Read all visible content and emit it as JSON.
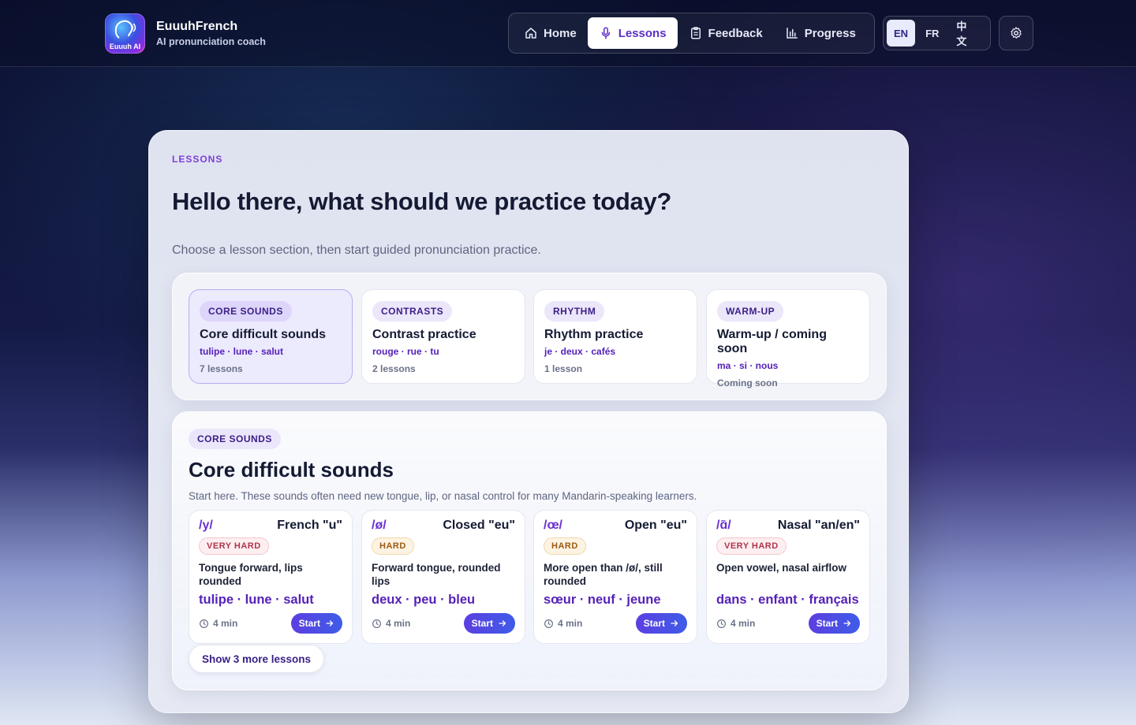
{
  "brand": {
    "logo_text": "Euuuh AI",
    "name": "EuuuhFrench",
    "tagline": "AI pronunciation coach"
  },
  "nav": {
    "items": [
      {
        "label": "Home",
        "icon": "home-icon",
        "active": false
      },
      {
        "label": "Lessons",
        "icon": "microphone-icon",
        "active": true
      },
      {
        "label": "Feedback",
        "icon": "clipboard-icon",
        "active": false
      },
      {
        "label": "Progress",
        "icon": "bar-chart-icon",
        "active": false
      }
    ]
  },
  "languages": {
    "items": [
      "EN",
      "FR",
      "中文"
    ],
    "selected": "EN"
  },
  "settings_icon": "gear-icon",
  "hero": {
    "eyebrow": "LESSONS",
    "title": "Hello there, what should we practice today?",
    "subtitle": "Choose a lesson section, then start guided pronunciation practice."
  },
  "sections": [
    {
      "tag": "CORE SOUNDS",
      "title": "Core difficult sounds",
      "words": "tulipe · lune · salut",
      "count": "7 lessons",
      "active": true
    },
    {
      "tag": "CONTRASTS",
      "title": "Contrast practice",
      "words": "rouge · rue · tu",
      "count": "2 lessons",
      "active": false
    },
    {
      "tag": "RHYTHM",
      "title": "Rhythm practice",
      "words": "je · deux · cafés",
      "count": "1 lesson",
      "active": false
    },
    {
      "tag": "WARM-UP",
      "title": "Warm-up / coming soon",
      "words": "ma · si · nous",
      "count": "Coming soon",
      "active": false
    }
  ],
  "lesson_section": {
    "tag": "CORE SOUNDS",
    "title": "Core difficult sounds",
    "description": "Start here. These sounds often need new tongue, lip, or nasal control for many Mandarin-speaking learners.",
    "show_more": "Show 3 more lessons",
    "cards": [
      {
        "ipa": "/y/",
        "name": "French \"u\"",
        "difficulty": "VERY HARD",
        "hint": "Tongue forward, lips rounded",
        "words": "tulipe · lune · salut",
        "duration": "4 min",
        "start": "Start"
      },
      {
        "ipa": "/ø/",
        "name": "Closed \"eu\"",
        "difficulty": "HARD",
        "hint": "Forward tongue, rounded lips",
        "words": "deux · peu · bleu",
        "duration": "4 min",
        "start": "Start"
      },
      {
        "ipa": "/œ/",
        "name": "Open \"eu\"",
        "difficulty": "HARD",
        "hint": "More open than /ø/, still rounded",
        "words": "sœur · neuf · jeune",
        "duration": "4 min",
        "start": "Start"
      },
      {
        "ipa": "/ɑ̃/",
        "name": "Nasal \"an/en\"",
        "difficulty": "VERY HARD",
        "hint": "Open vowel, nasal airflow",
        "words": "dans · enfant · français",
        "duration": "4 min",
        "start": "Start"
      }
    ]
  },
  "colors": {
    "accent": "#5b2fc4",
    "accent_text": "#5521b8",
    "very_hard": "#b0354b",
    "hard": "#9b5a12",
    "start_button": "#4f4ae4"
  }
}
